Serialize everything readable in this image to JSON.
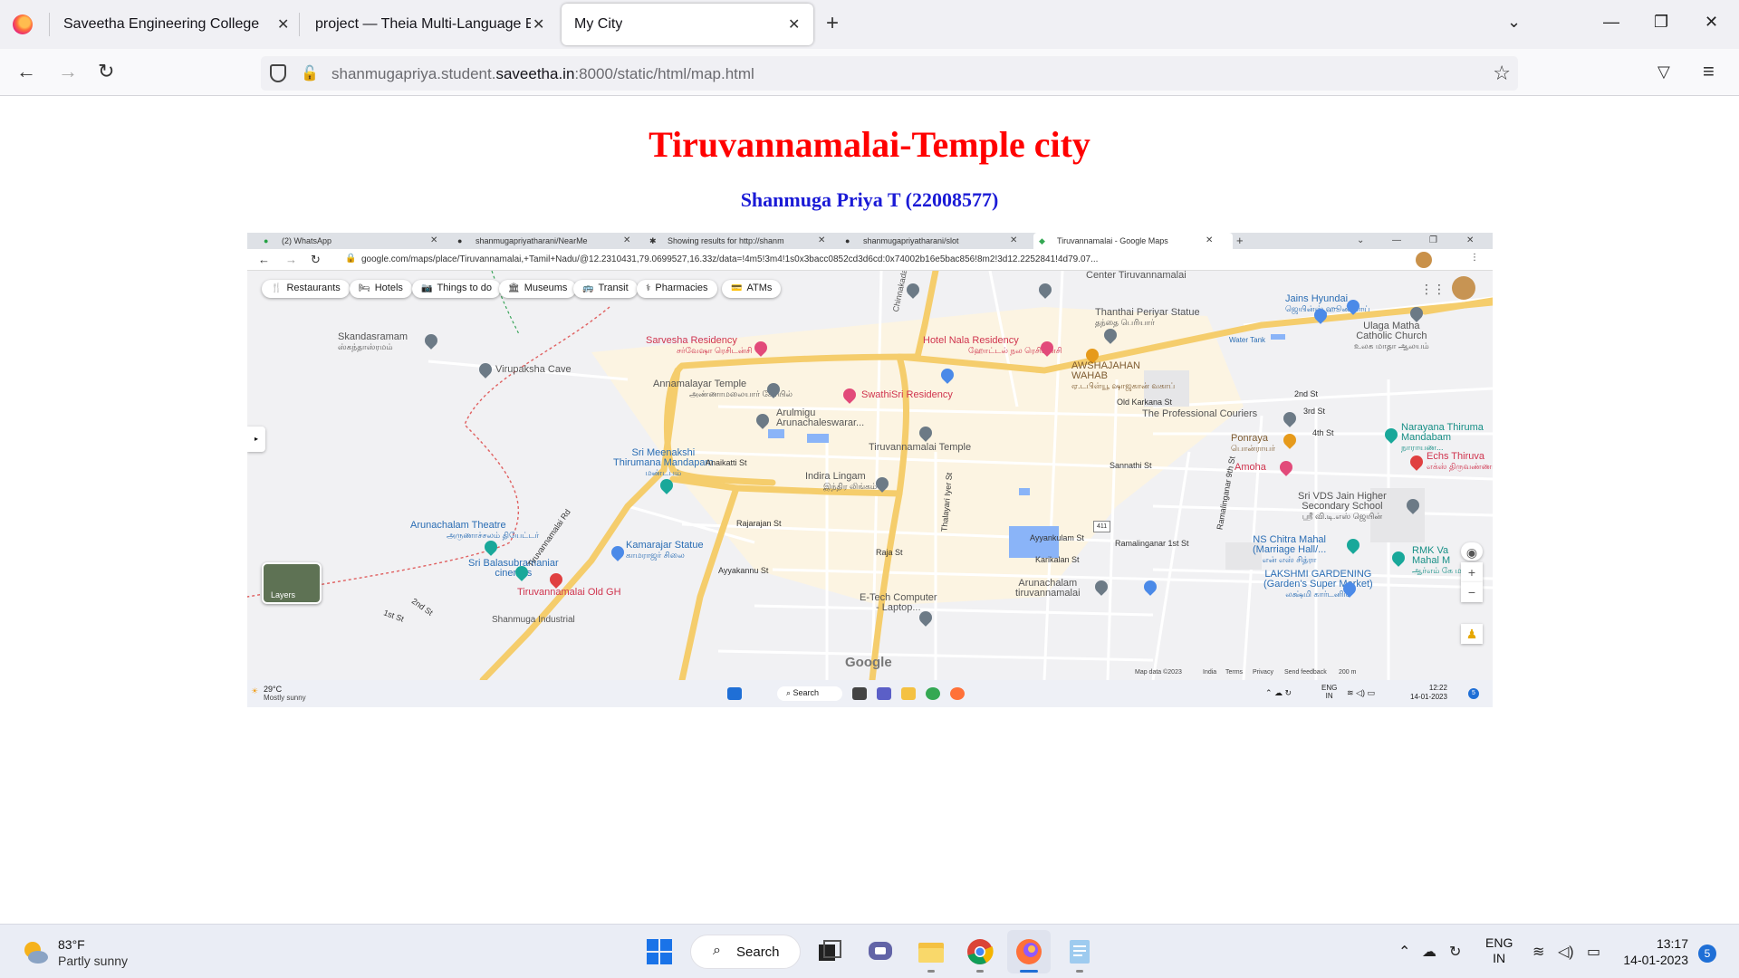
{
  "browser": {
    "tabs": [
      {
        "title": "Saveetha Engineering College"
      },
      {
        "title": "project — Theia Multi-Language Ex"
      },
      {
        "title": "My City",
        "active": true
      }
    ],
    "url_prefix": "shanmugapriya.student.",
    "url_domain": "saveetha.in",
    "url_suffix": ":8000/static/html/map.html"
  },
  "page": {
    "title": "Tiruvannamalai-Temple city",
    "subtitle": "Shanmuga Priya T (22008577)"
  },
  "screenshot": {
    "tabs": [
      {
        "title": "(2) WhatsApp"
      },
      {
        "title": "shanmugapriyatharani/NearMe"
      },
      {
        "title": "Showing results for http://shanm"
      },
      {
        "title": "shanmugapriyatharani/slot"
      },
      {
        "title": "Tiruvannamalai - Google Maps",
        "active": true
      }
    ],
    "url": "google.com/maps/place/Tiruvannamalai,+Tamil+Nadu/@12.2310431,79.0699527,16.33z/data=!4m5!3m4!1s0x3bacc0852cd3d6cd:0x74002b16e5bac856!8m2!3d12.2252841!4d79.07...",
    "chips": [
      "Restaurants",
      "Hotels",
      "Things to do",
      "Museums",
      "Transit",
      "Pharmacies",
      "ATMs"
    ],
    "places": {
      "skandasramam": {
        "name": "Skandasramam",
        "tamil": "ஸ்கந்தாஸ்ரமம்"
      },
      "virupaksha": {
        "name": "Virupaksha Cave"
      },
      "sarvesha": {
        "name": "Sarvesha Residency",
        "tamil": "சர்வேஷா ரெசிடன்சி"
      },
      "annamalayar": {
        "name": "Annamalayar Temple",
        "tamil": "அண்ணாமலையார் கோயில்"
      },
      "swathisri": {
        "name": "SwathiSri Residency"
      },
      "arulmigu": {
        "name": "Arulmigu",
        "name2": "Arunachaleswarar..."
      },
      "meenakshi": {
        "name": "Sri Meenakshi",
        "name2": "Thirumana Mandapam",
        "tamil": "மண்டபம்"
      },
      "indira": {
        "name": "Indira Lingam",
        "tamil": "இந்திர லிங்கம்"
      },
      "temple": {
        "name": "Tiruvannamalai Temple"
      },
      "arunachalam_theatre": {
        "name": "Arunachalam Theatre",
        "tamil": "அருணாச்சலம் தியேட்டர்"
      },
      "balasubramaniar": {
        "name": "Sri Balasubramaniar",
        "name2": "cinemas"
      },
      "kamarajar": {
        "name": "Kamarajar Statue",
        "tamil": "காமராஜர் சிலை"
      },
      "old_gh": {
        "name": "Tiruvannamalai Old GH"
      },
      "etech": {
        "name": "E-Tech Computer",
        "name2": "- Laptop..."
      },
      "arunachalam_tvm": {
        "name": "Arunachalam",
        "name2": "tiruvannamalai"
      },
      "shanmuga_ind": {
        "name": "Shanmuga Industrial"
      },
      "hotel_nala": {
        "name": "Hotel Nala Residency",
        "tamil": "ஹோட்டல் நல ரெசிடன்சி"
      },
      "awshajahan": {
        "name": "AWSHAJAHAN",
        "name2": "WAHAB",
        "tamil": "ஏ.டபிள்யூ ஷாஜகான் வகாப்"
      },
      "thanthai": {
        "name": "Thanthai Periyar Statue",
        "tamil": "தந்தை பெரியார்"
      },
      "center_tvm": {
        "name": "Center Tiruvannamalai"
      },
      "jains": {
        "name": "Jains Hyundai",
        "tamil": "ஜெயின்ஸ் ஹூண்டாய்"
      },
      "ulaga": {
        "name": "Ulaga Matha",
        "name2": "Catholic Church",
        "tamil": "உலக மாதா ஆலயம்"
      },
      "water_tank": {
        "name": "Water Tank"
      },
      "prof_couriers": {
        "name": "The Professional Couriers"
      },
      "narayana": {
        "name": "Narayana Thiruma",
        "name2": "Mandabam",
        "tamil": "நாராயண..."
      },
      "ponraya": {
        "name": "Ponraya",
        "tamil": "பொன்ராயர்"
      },
      "amoha": {
        "name": "Amoha"
      },
      "echs": {
        "name": "Echs Thiruva",
        "tamil": "எக்ஸ் திருவண்ணாம"
      },
      "vds": {
        "name": "Sri VDS Jain Higher",
        "name2": "Secondary School",
        "tamil": "ஸ்ரீ வி.டி.எஸ் ஜெயின்"
      },
      "ns_chitra": {
        "name": "NS Chitra Mahal",
        "name2": "(Marriage Hall/...",
        "tamil": "என் எஸ் சித்ரா"
      },
      "rmk": {
        "name": "RMK Va",
        "name2": "Mahal M",
        "tamil": "ஆர்எம் கே மஹால்"
      },
      "lakshmi": {
        "name": "LAKSHMI GARDENING",
        "name2": "(Garden's Super Market)",
        "tamil": "லக்ஷ்மி கார்டனிங்"
      }
    },
    "streets": {
      "chinnakadai": "Chinnakadai St",
      "old_karkana": "Old Karkana St",
      "second": "2nd St",
      "third": "3rd St",
      "fourth": "4th St",
      "anaikatti": "Anaikatti St",
      "sannathi": "Sannathi St",
      "thiruvannamalai_rd": "Tiruvannamalai Rd",
      "rajarajan": "Rajarajan St",
      "raja": "Raja St",
      "ayyakannu": "Ayyakannu St",
      "ayyankulam": "Ayyankulam St",
      "karikalan": "Karikalan St",
      "ramalinganar": "Ramalinganar 1st St",
      "ramalinganar_9": "Ramalinganar 9th St",
      "thalayari": "Thalayari Iyer St",
      "second_st_left": "2nd St",
      "first_st_left": "1st St",
      "road_badge": "411"
    },
    "layers_label": "Layers",
    "google_logo": "Google",
    "attribution": [
      "Map data ©2023",
      "India",
      "Terms",
      "Privacy",
      "Send feedback",
      "200 m"
    ],
    "taskbar": {
      "temp": "29°C",
      "condition": "Mostly sunny",
      "search": "Search",
      "lang_top": "ENG",
      "lang_bottom": "IN",
      "time": "12:22",
      "date": "14-01-2023",
      "badge": "5"
    }
  },
  "taskbar": {
    "temp": "83°F",
    "condition": "Partly sunny",
    "search": "Search",
    "lang_top": "ENG",
    "lang_bottom": "IN",
    "time": "13:17",
    "date": "14-01-2023",
    "notifications": "5"
  }
}
